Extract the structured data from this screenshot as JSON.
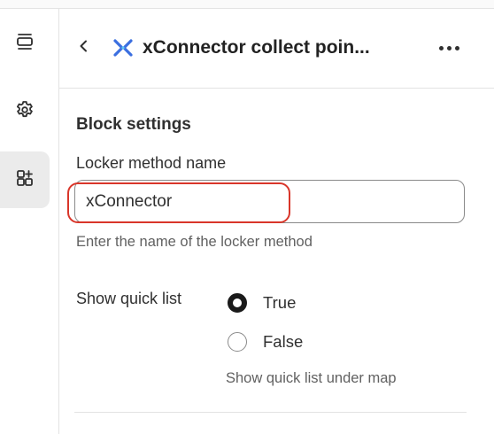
{
  "rail": {
    "items": [
      {
        "icon": "sections-icon",
        "active": false
      },
      {
        "icon": "gear-icon",
        "active": false
      },
      {
        "icon": "apps-add-icon",
        "active": true
      }
    ]
  },
  "header": {
    "title": "xConnector collect poin...",
    "logo_icon": "xconnector-logo-icon",
    "logo_color": "#3b6fe0",
    "back_icon": "chevron-left-icon",
    "more_icon": "more-horizontal-icon"
  },
  "settings": {
    "section_title": "Block settings",
    "locker_label": "Locker method name",
    "locker_value": "xConnector",
    "locker_help": "Enter the name of the locker method",
    "highlight_color": "#d9362a",
    "quick_list_label": "Show quick list",
    "quick_list_options": [
      {
        "label": "True",
        "checked": true
      },
      {
        "label": "False",
        "checked": false
      }
    ],
    "quick_list_help": "Show quick list under map"
  }
}
